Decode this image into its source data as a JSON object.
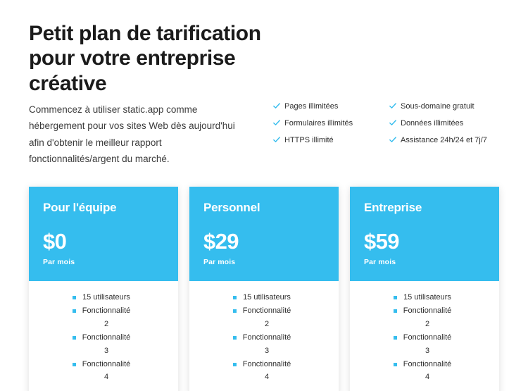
{
  "hero": {
    "title": "Petit plan de tarification\npour votre entreprise\ncréative",
    "intro": "Commencez à utiliser static.app comme hébergement pour vos sites Web dès aujourd'hui afin d'obtenir le meilleur rapport fonctionnalités/argent du marché."
  },
  "features": {
    "icon": "check-icon",
    "accent_color": "#35bdee",
    "columns": [
      {
        "items": [
          "Pages illimitées",
          "Formulaires illimités",
          "HTTPS illimité"
        ]
      },
      {
        "items": [
          "Sous-domaine gratuit",
          "Données illimitées",
          "Assistance 24h/24 et 7j/7"
        ]
      }
    ]
  },
  "pricing": {
    "header_color": "#35bdee",
    "bullet_color": "#35bdee",
    "cards": [
      {
        "name": "Pour l'équipe",
        "price": "$0",
        "period": "Par mois",
        "features": [
          "15 utilisateurs",
          "Fonctionnalité 2",
          "Fonctionnalité 3",
          "Fonctionnalité 4"
        ]
      },
      {
        "name": "Personnel",
        "price": "$29",
        "period": "Par mois",
        "features": [
          "15 utilisateurs",
          "Fonctionnalité 2",
          "Fonctionnalité 3",
          "Fonctionnalité 4"
        ]
      },
      {
        "name": "Entreprise",
        "price": "$59",
        "period": "Par mois",
        "features": [
          "15 utilisateurs",
          "Fonctionnalité 2",
          "Fonctionnalité 3",
          "Fonctionnalité 4"
        ]
      }
    ]
  }
}
